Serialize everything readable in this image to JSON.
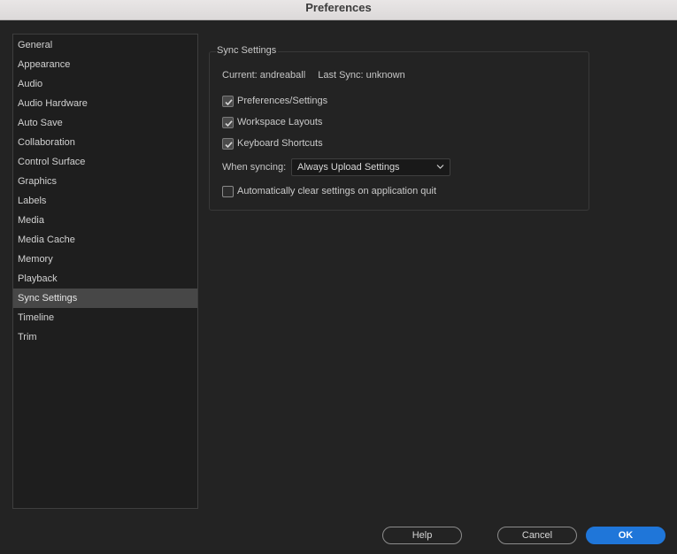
{
  "window": {
    "title": "Preferences"
  },
  "sidebar": {
    "items": [
      {
        "label": "General"
      },
      {
        "label": "Appearance"
      },
      {
        "label": "Audio"
      },
      {
        "label": "Audio Hardware"
      },
      {
        "label": "Auto Save"
      },
      {
        "label": "Collaboration"
      },
      {
        "label": "Control Surface"
      },
      {
        "label": "Graphics"
      },
      {
        "label": "Labels"
      },
      {
        "label": "Media"
      },
      {
        "label": "Media Cache"
      },
      {
        "label": "Memory"
      },
      {
        "label": "Playback"
      },
      {
        "label": "Sync Settings"
      },
      {
        "label": "Timeline"
      },
      {
        "label": "Trim"
      }
    ],
    "selected": "Sync Settings"
  },
  "sync": {
    "group_title": "Sync Settings",
    "current": "Current: andreaball",
    "last_sync": "Last Sync: unknown",
    "options": [
      {
        "label": "Preferences/Settings",
        "checked": true
      },
      {
        "label": "Workspace Layouts",
        "checked": true
      },
      {
        "label": "Keyboard Shortcuts",
        "checked": true
      }
    ],
    "when_syncing_label": "When syncing:",
    "when_syncing_value": "Always Upload Settings",
    "auto_clear": {
      "label": "Automatically clear settings on application quit",
      "checked": false
    }
  },
  "buttons": {
    "help": "Help",
    "cancel": "Cancel",
    "ok": "OK"
  },
  "colors": {
    "accent": "#1f76d9",
    "background": "#232323",
    "panel": "#1e1e1e",
    "selection": "#474747"
  }
}
